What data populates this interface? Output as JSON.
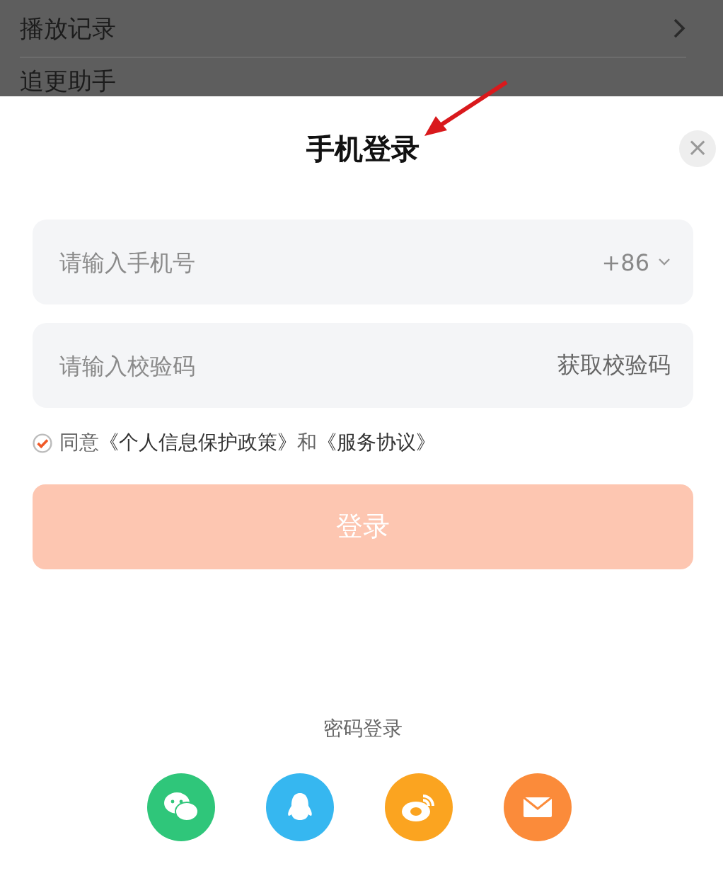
{
  "background_list": {
    "items": [
      {
        "label": "播放记录",
        "chevron": true
      },
      {
        "label": "追更助手",
        "chevron": false
      }
    ]
  },
  "sheet": {
    "title": "手机登录",
    "close": "×"
  },
  "phone_field": {
    "placeholder": "请输入手机号",
    "country_code": "+86"
  },
  "code_field": {
    "placeholder": "请输入校验码",
    "action": "获取校验码"
  },
  "agreement": {
    "checked": true,
    "prefix": "同意",
    "links": [
      "《个人信息保护政策》",
      "《服务协议》"
    ],
    "joiner": "和"
  },
  "login_button": {
    "label": "登录",
    "disabled": true
  },
  "password_login": "密码登录",
  "social_logins": [
    {
      "kind": "wechat",
      "color": "#2fc67a"
    },
    {
      "kind": "qq",
      "color": "#36b7f0"
    },
    {
      "kind": "weibo",
      "color": "#fba420"
    },
    {
      "kind": "mail",
      "color": "#fb8b3a"
    }
  ]
}
